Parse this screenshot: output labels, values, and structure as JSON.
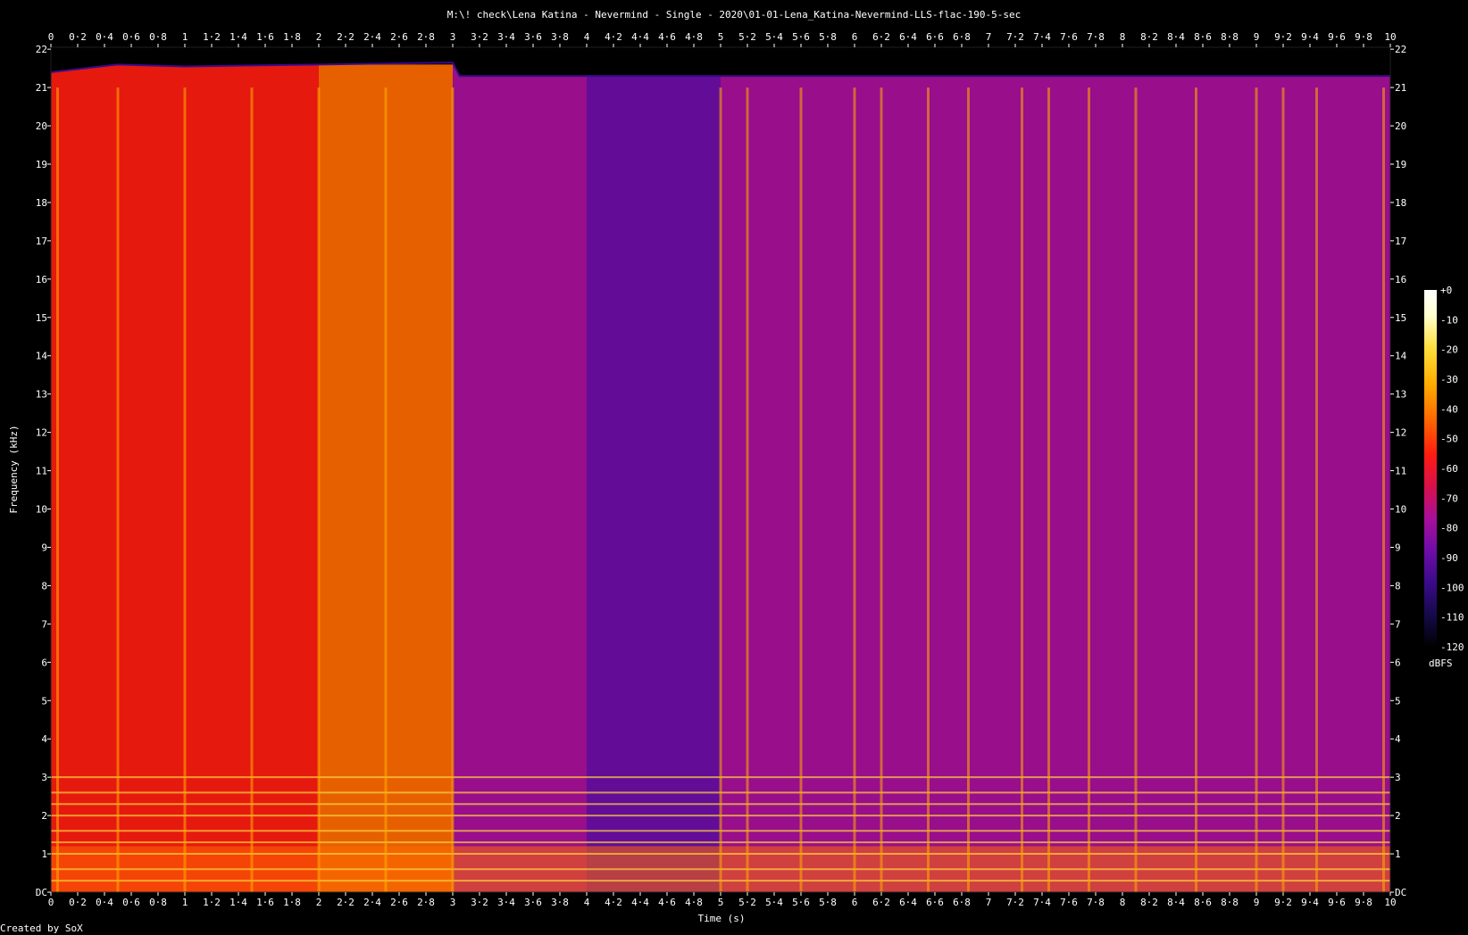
{
  "chart_data": {
    "type": "heatmap",
    "title": "M:\\! check\\Lena Katina - Nevermind - Single - 2020\\01-01-Lena_Katina-Nevermind-LLS-flac-190-5-sec",
    "xlabel": "Time (s)",
    "ylabel": "Frequency (kHz)",
    "footer": "Created by SoX",
    "colorbar_unit": "dBFS",
    "xlim": [
      0,
      10
    ],
    "ylim": [
      0,
      22.05
    ],
    "x_ticks": [
      0,
      0.2,
      0.4,
      0.6,
      0.8,
      1,
      1.2,
      1.4,
      1.6,
      1.8,
      2,
      2.2,
      2.4,
      2.6,
      2.8,
      3,
      3.2,
      3.4,
      3.6,
      3.8,
      4,
      4.2,
      4.4,
      4.6,
      4.8,
      5,
      5.2,
      5.4,
      5.6,
      5.8,
      6,
      6.2,
      6.4,
      6.6,
      6.8,
      7,
      7.2,
      7.4,
      7.6,
      7.8,
      8,
      8.2,
      8.4,
      8.6,
      8.8,
      9,
      9.2,
      9.4,
      9.6,
      9.8,
      10
    ],
    "x_tick_labels": [
      "0",
      "0·2",
      "0·4",
      "0·6",
      "0·8",
      "1",
      "1·2",
      "1·4",
      "1·6",
      "1·8",
      "2",
      "2·2",
      "2·4",
      "2·6",
      "2·8",
      "3",
      "3·2",
      "3·4",
      "3·6",
      "3·8",
      "4",
      "4·2",
      "4·4",
      "4·6",
      "4·8",
      "5",
      "5·2",
      "5·4",
      "5·6",
      "5·8",
      "6",
      "6·2",
      "6·4",
      "6·6",
      "6·8",
      "7",
      "7·2",
      "7·4",
      "7·6",
      "7·8",
      "8",
      "8·2",
      "8·4",
      "8·6",
      "8·8",
      "9",
      "9·2",
      "9·4",
      "9·6",
      "9·8",
      "10"
    ],
    "y_ticks": [
      0,
      1,
      2,
      3,
      4,
      5,
      6,
      7,
      8,
      9,
      10,
      11,
      12,
      13,
      14,
      15,
      16,
      17,
      18,
      19,
      20,
      21,
      22
    ],
    "y_tick_labels": [
      "DC",
      "1",
      "2",
      "3",
      "4",
      "5",
      "6",
      "7",
      "8",
      "9",
      "10",
      "11",
      "12",
      "13",
      "14",
      "15",
      "16",
      "17",
      "18",
      "19",
      "20",
      "21",
      "22"
    ],
    "colorbar_ticks": [
      0,
      -10,
      -20,
      -30,
      -40,
      -50,
      -60,
      -70,
      -80,
      -90,
      -100,
      -110,
      -120
    ],
    "colorbar_tick_labels": [
      "+0",
      "-10",
      "-20",
      "-30",
      "-40",
      "-50",
      "-60",
      "-70",
      "-80",
      "-90",
      "-100",
      "-110",
      "-120"
    ],
    "colormap": [
      "#000000",
      "#160a4a",
      "#3a0b8a",
      "#6e0da8",
      "#a80f9a",
      "#d8104a",
      "#ff1c10",
      "#ff6a00",
      "#ffae00",
      "#ffe040",
      "#ffffd0",
      "#ffffff"
    ],
    "cutoff_khz": [
      {
        "t": 0,
        "f": 21.4
      },
      {
        "t": 0.5,
        "f": 21.6
      },
      {
        "t": 1.0,
        "f": 21.55
      },
      {
        "t": 2.0,
        "f": 21.6
      },
      {
        "t": 3.0,
        "f": 21.65
      },
      {
        "t": 3.05,
        "f": 21.3
      },
      {
        "t": 10,
        "f": 21.3
      }
    ],
    "loud_regions": [
      {
        "t0": 0.0,
        "t1": 0.5,
        "f_max": 21.0,
        "level_db": -60
      },
      {
        "t0": 0.5,
        "t1": 1.2,
        "f_max": 21.0,
        "level_db": -55
      },
      {
        "t0": 1.2,
        "t1": 2.0,
        "f_max": 21.0,
        "level_db": -50
      },
      {
        "t0": 2.0,
        "t1": 3.0,
        "f_max": 21.0,
        "level_db": -45
      },
      {
        "t0": 3.0,
        "t1": 4.0,
        "f_max": 21.0,
        "level_db": -80
      },
      {
        "t0": 4.0,
        "t1": 5.0,
        "f_max": 21.0,
        "level_db": -85
      },
      {
        "t0": 5.0,
        "t1": 10.0,
        "f_max": 21.0,
        "level_db": -78
      }
    ],
    "harmonic_lines_khz": [
      0.3,
      0.6,
      1.0,
      1.3,
      1.6,
      2.0,
      2.3,
      2.6,
      3.0
    ],
    "transients_s": [
      0.05,
      0.5,
      1.0,
      1.5,
      2.0,
      2.5,
      3.0,
      5.0,
      5.2,
      5.6,
      6.0,
      6.2,
      6.55,
      6.85,
      7.25,
      7.45,
      7.75,
      8.1,
      8.55,
      9.0,
      9.2,
      9.45,
      9.95
    ]
  }
}
